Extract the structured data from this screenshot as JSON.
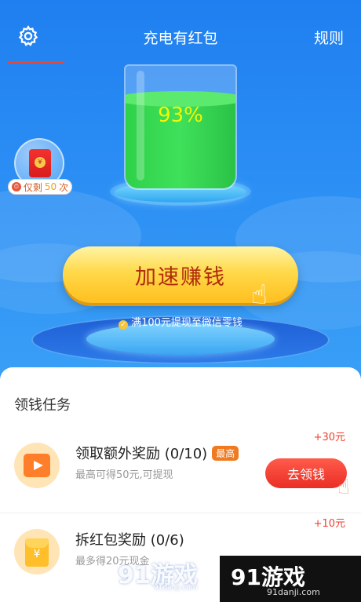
{
  "header": {
    "title": "充电有红包",
    "rules_label": "规则"
  },
  "battery": {
    "percent_label": "93%",
    "level": 0.93
  },
  "redpack_badge": {
    "prefix": "仅剩",
    "count": "50",
    "suffix": "次",
    "coin_symbol": "¥"
  },
  "cta": {
    "label": "加速赚钱"
  },
  "withdraw_note": "满100元提现至微信零钱",
  "tasks_section": {
    "title": "领钱任务",
    "items": [
      {
        "name": "领取额外奖励 (0/10)",
        "tag": "最高",
        "desc": "最高可得50元,可提现",
        "reward": "+30元",
        "button": "去领钱"
      },
      {
        "name": "拆红包奖励 (0/6)",
        "desc": "最多得20元现金",
        "reward": "+10元"
      }
    ]
  },
  "watermarks": {
    "left": "91游戏",
    "left_sub": "91danji.com",
    "right": "91游戏",
    "right_sub": "91danji.com"
  },
  "colors": {
    "hero_blue": "#2b8ef4",
    "battery_green": "#2fd14a",
    "cta_yellow": "#ffd94a",
    "cta_text": "#b02a0e",
    "task_button": "#ea2e26",
    "reward_red": "#ee3f2f"
  }
}
